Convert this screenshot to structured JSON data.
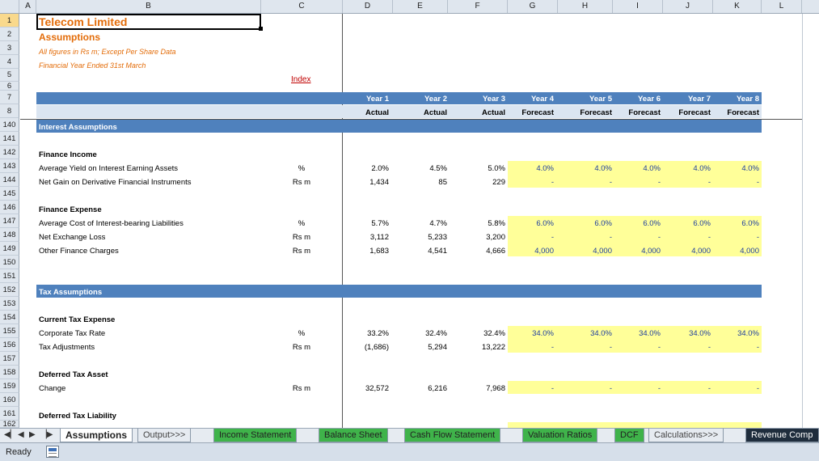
{
  "columns": [
    "A",
    "B",
    "C",
    "D",
    "E",
    "F",
    "G",
    "H",
    "I",
    "J",
    "K",
    "L"
  ],
  "rows": [
    "1",
    "2",
    "3",
    "4",
    "5",
    "6",
    "7",
    "8",
    "140",
    "141",
    "142",
    "143",
    "144",
    "145",
    "146",
    "147",
    "148",
    "149",
    "150",
    "151",
    "152",
    "153",
    "154",
    "155",
    "156",
    "157",
    "158",
    "159",
    "160",
    "161",
    "162"
  ],
  "title": "Telecom Limited",
  "subtitle": "Assumptions",
  "note1": "All figures in Rs m; Except Per Share Data",
  "note2": "Financial Year Ended 31st March",
  "index_link": "Index",
  "years": [
    "Year 1",
    "Year 2",
    "Year 3",
    "Year 4",
    "Year 5",
    "Year 6",
    "Year 7",
    "Year 8"
  ],
  "periods": [
    "Actual",
    "Actual",
    "Actual",
    "Forecast",
    "Forecast",
    "Forecast",
    "Forecast",
    "Forecast"
  ],
  "sections": {
    "interest": "Interest Assumptions",
    "tax": "Tax Assumptions"
  },
  "lines": {
    "finance_income": "Finance Income",
    "avg_yield": {
      "label": "Average Yield on Interest Earning Assets",
      "unit": "%",
      "values": [
        "2.0%",
        "4.5%",
        "5.0%",
        "4.0%",
        "4.0%",
        "4.0%",
        "4.0%",
        "4.0%"
      ]
    },
    "net_gain": {
      "label": "Net Gain on Derivative Financial Instruments",
      "unit": "Rs m",
      "values": [
        "1,434",
        "85",
        "229",
        "-",
        "-",
        "-",
        "-",
        "-"
      ]
    },
    "finance_expense": "Finance Expense",
    "avg_cost": {
      "label": "Average Cost of Interest-bearing Liabilities",
      "unit": "%",
      "values": [
        "5.7%",
        "4.7%",
        "5.8%",
        "6.0%",
        "6.0%",
        "6.0%",
        "6.0%",
        "6.0%"
      ]
    },
    "net_exchange": {
      "label": "Net Exchange Loss",
      "unit": "Rs m",
      "values": [
        "3,112",
        "5,233",
        "3,200",
        "-",
        "-",
        "-",
        "-",
        "-"
      ]
    },
    "other_fin": {
      "label": "Other Finance Charges",
      "unit": "Rs m",
      "values": [
        "1,683",
        "4,541",
        "4,666",
        "4,000",
        "4,000",
        "4,000",
        "4,000",
        "4,000"
      ]
    },
    "current_tax": "Current Tax Expense",
    "corp_tax": {
      "label": "Corporate Tax Rate",
      "unit": "%",
      "values": [
        "33.2%",
        "32.4%",
        "32.4%",
        "34.0%",
        "34.0%",
        "34.0%",
        "34.0%",
        "34.0%"
      ]
    },
    "tax_adj": {
      "label": "Tax Adjustments",
      "unit": "Rs m",
      "values": [
        "(1,686)",
        "5,294",
        "13,222",
        "-",
        "-",
        "-",
        "-",
        "-"
      ]
    },
    "deferred_asset": "Deferred Tax Asset",
    "change": {
      "label": "Change",
      "unit": "Rs m",
      "values": [
        "32,572",
        "6,216",
        "7,968",
        "-",
        "-",
        "-",
        "-",
        "-"
      ]
    },
    "deferred_liab": "Deferred Tax Liability"
  },
  "tabs": [
    "Assumptions",
    "Output>>>",
    "Income Statement",
    "Balance Sheet",
    "Cash Flow Statement",
    "Valuation Ratios",
    "DCF",
    "Calculations>>>",
    "Revenue Comp"
  ],
  "status": "Ready",
  "colors": {
    "band": "#4f81bd",
    "light": "#dbe5f1",
    "input": "#ffff99",
    "title": "#e36c09"
  }
}
